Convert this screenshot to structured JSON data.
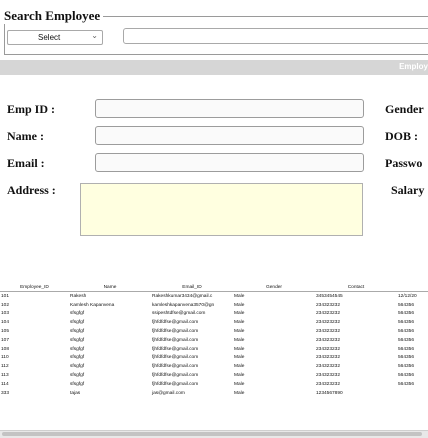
{
  "search": {
    "legend": "Search Employee",
    "select_value": "Select",
    "search_value": ""
  },
  "section_bar": {
    "title": "Employ"
  },
  "form": {
    "emp_id_label": "Emp ID :",
    "name_label": "Name :",
    "email_label": "Email :",
    "address_label": "Address :",
    "gender_label": "Gender",
    "dob_label": "DOB :",
    "password_label": "Passwo",
    "salary_label": "Salary"
  },
  "table": {
    "columns": [
      "Employee_ID",
      "Name",
      "Email_ID",
      "Gender",
      "Contact",
      ""
    ],
    "rows": [
      [
        "101",
        "Rakesh",
        "Rakeshkumar3434@gmail.c",
        "Male",
        "3453454545",
        "12/12/20"
      ],
      [
        "102",
        "Kamlesh Kapanvena",
        "kamleshkapanvena3570@gn",
        "Male",
        "234323232",
        "564356"
      ],
      [
        "103",
        "sfsgfgf",
        "ssipeshtdfse@gmail.com",
        "Male",
        "234323232",
        "564356"
      ],
      [
        "104",
        "sfsgfgf",
        "fjhfdfdfse@gmail.com",
        "Male",
        "234323232",
        "564356"
      ],
      [
        "105",
        "sfsgfgf",
        "fjhfdfdfse@gmail.com",
        "Male",
        "234323232",
        "564356"
      ],
      [
        "107",
        "sfsgfgf",
        "fjhfdfdfse@gmail.com",
        "Male",
        "234323232",
        "564356"
      ],
      [
        "108",
        "sfsgfgf",
        "fjhfdfdfse@gmail.com",
        "Male",
        "234323232",
        "564356"
      ],
      [
        "110",
        "sfsgfgf",
        "fjhfdfdfse@gmail.com",
        "Male",
        "234323232",
        "564356"
      ],
      [
        "112",
        "sfsgfgf",
        "fjhfdfdfse@gmail.com",
        "Male",
        "234323232",
        "564356"
      ],
      [
        "113",
        "sfsgfgf",
        "fjhfdfdfse@gmail.com",
        "Male",
        "234323232",
        "564356"
      ],
      [
        "114",
        "sfsgfgf",
        "fjhfdfdfse@gmail.com",
        "Male",
        "234323232",
        "564356"
      ],
      [
        "333",
        "tajas",
        "jas@gmail.com",
        "Male",
        "1234567890",
        ""
      ]
    ]
  }
}
